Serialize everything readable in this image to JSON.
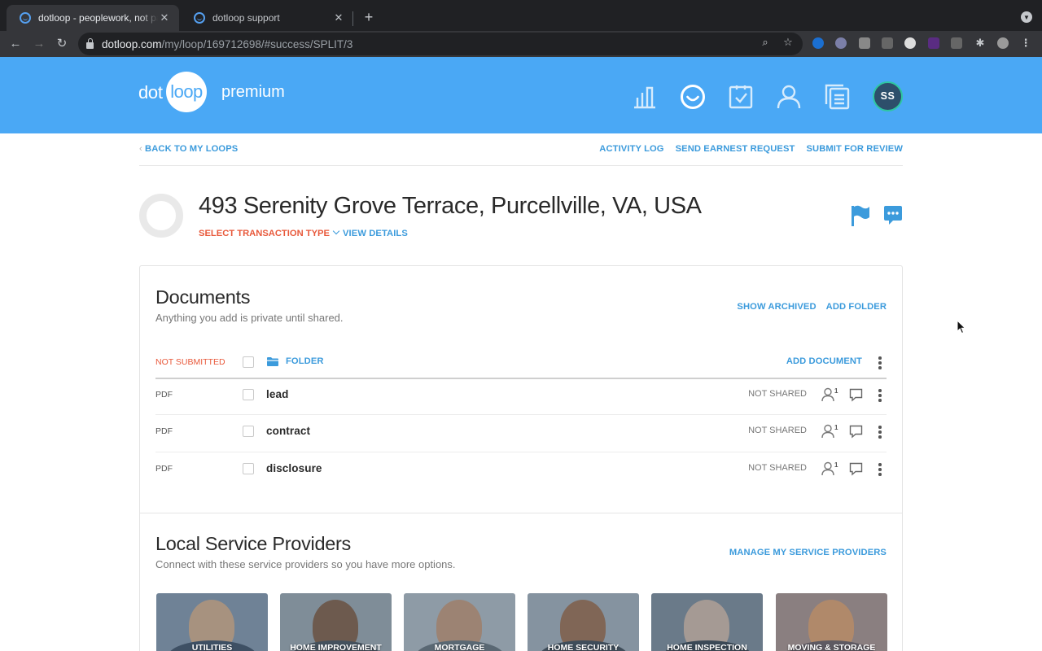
{
  "browser": {
    "tabs": [
      {
        "title": "dotloop - peoplework, not paperwork",
        "active": true
      },
      {
        "title": "dotloop support",
        "active": false
      }
    ],
    "url_domain": "dotloop.com",
    "url_path": "/my/loop/169712698/#success/SPLIT/3"
  },
  "header": {
    "logo_dot": "dot",
    "logo_loop": "loop",
    "logo_premium": "premium",
    "avatar_initials": "SS",
    "colors": {
      "brand": "#4aa8f5",
      "avatar_ring": "#2ec7a2"
    }
  },
  "subnav": {
    "back_label": "BACK TO MY LOOPS",
    "activity_log": "ACTIVITY LOG",
    "send_earnest": "SEND EARNEST REQUEST",
    "submit_review": "SUBMIT FOR REVIEW"
  },
  "loop": {
    "address": "493 Serenity Grove Terrace, Purcellville, VA, USA",
    "transaction_type_label": "SELECT TRANSACTION TYPE",
    "view_details": "VIEW DETAILS"
  },
  "documents": {
    "title": "Documents",
    "subtitle": "Anything you add is private until shared.",
    "show_archived": "SHOW ARCHIVED",
    "add_folder": "ADD FOLDER",
    "status_label": "NOT SUBMITTED",
    "folder_label": "FOLDER",
    "add_document": "ADD DOCUMENT",
    "rows": [
      {
        "type": "PDF",
        "name": "lead",
        "shared": "NOT SHARED",
        "participants": "1"
      },
      {
        "type": "PDF",
        "name": "contract",
        "shared": "NOT SHARED",
        "participants": "1"
      },
      {
        "type": "PDF",
        "name": "disclosure",
        "shared": "NOT SHARED",
        "participants": "1"
      }
    ]
  },
  "providers": {
    "title": "Local Service Providers",
    "subtitle": "Connect with these service providers so you have more options.",
    "manage_label": "MANAGE MY SERVICE PROVIDERS",
    "tiles": [
      {
        "label": "UTILITIES"
      },
      {
        "label": "HOME IMPROVEMENT"
      },
      {
        "label": "MORTGAGE"
      },
      {
        "label": "HOME SECURITY"
      },
      {
        "label": "HOME INSPECTION"
      },
      {
        "label": "MOVING & STORAGE"
      }
    ]
  }
}
